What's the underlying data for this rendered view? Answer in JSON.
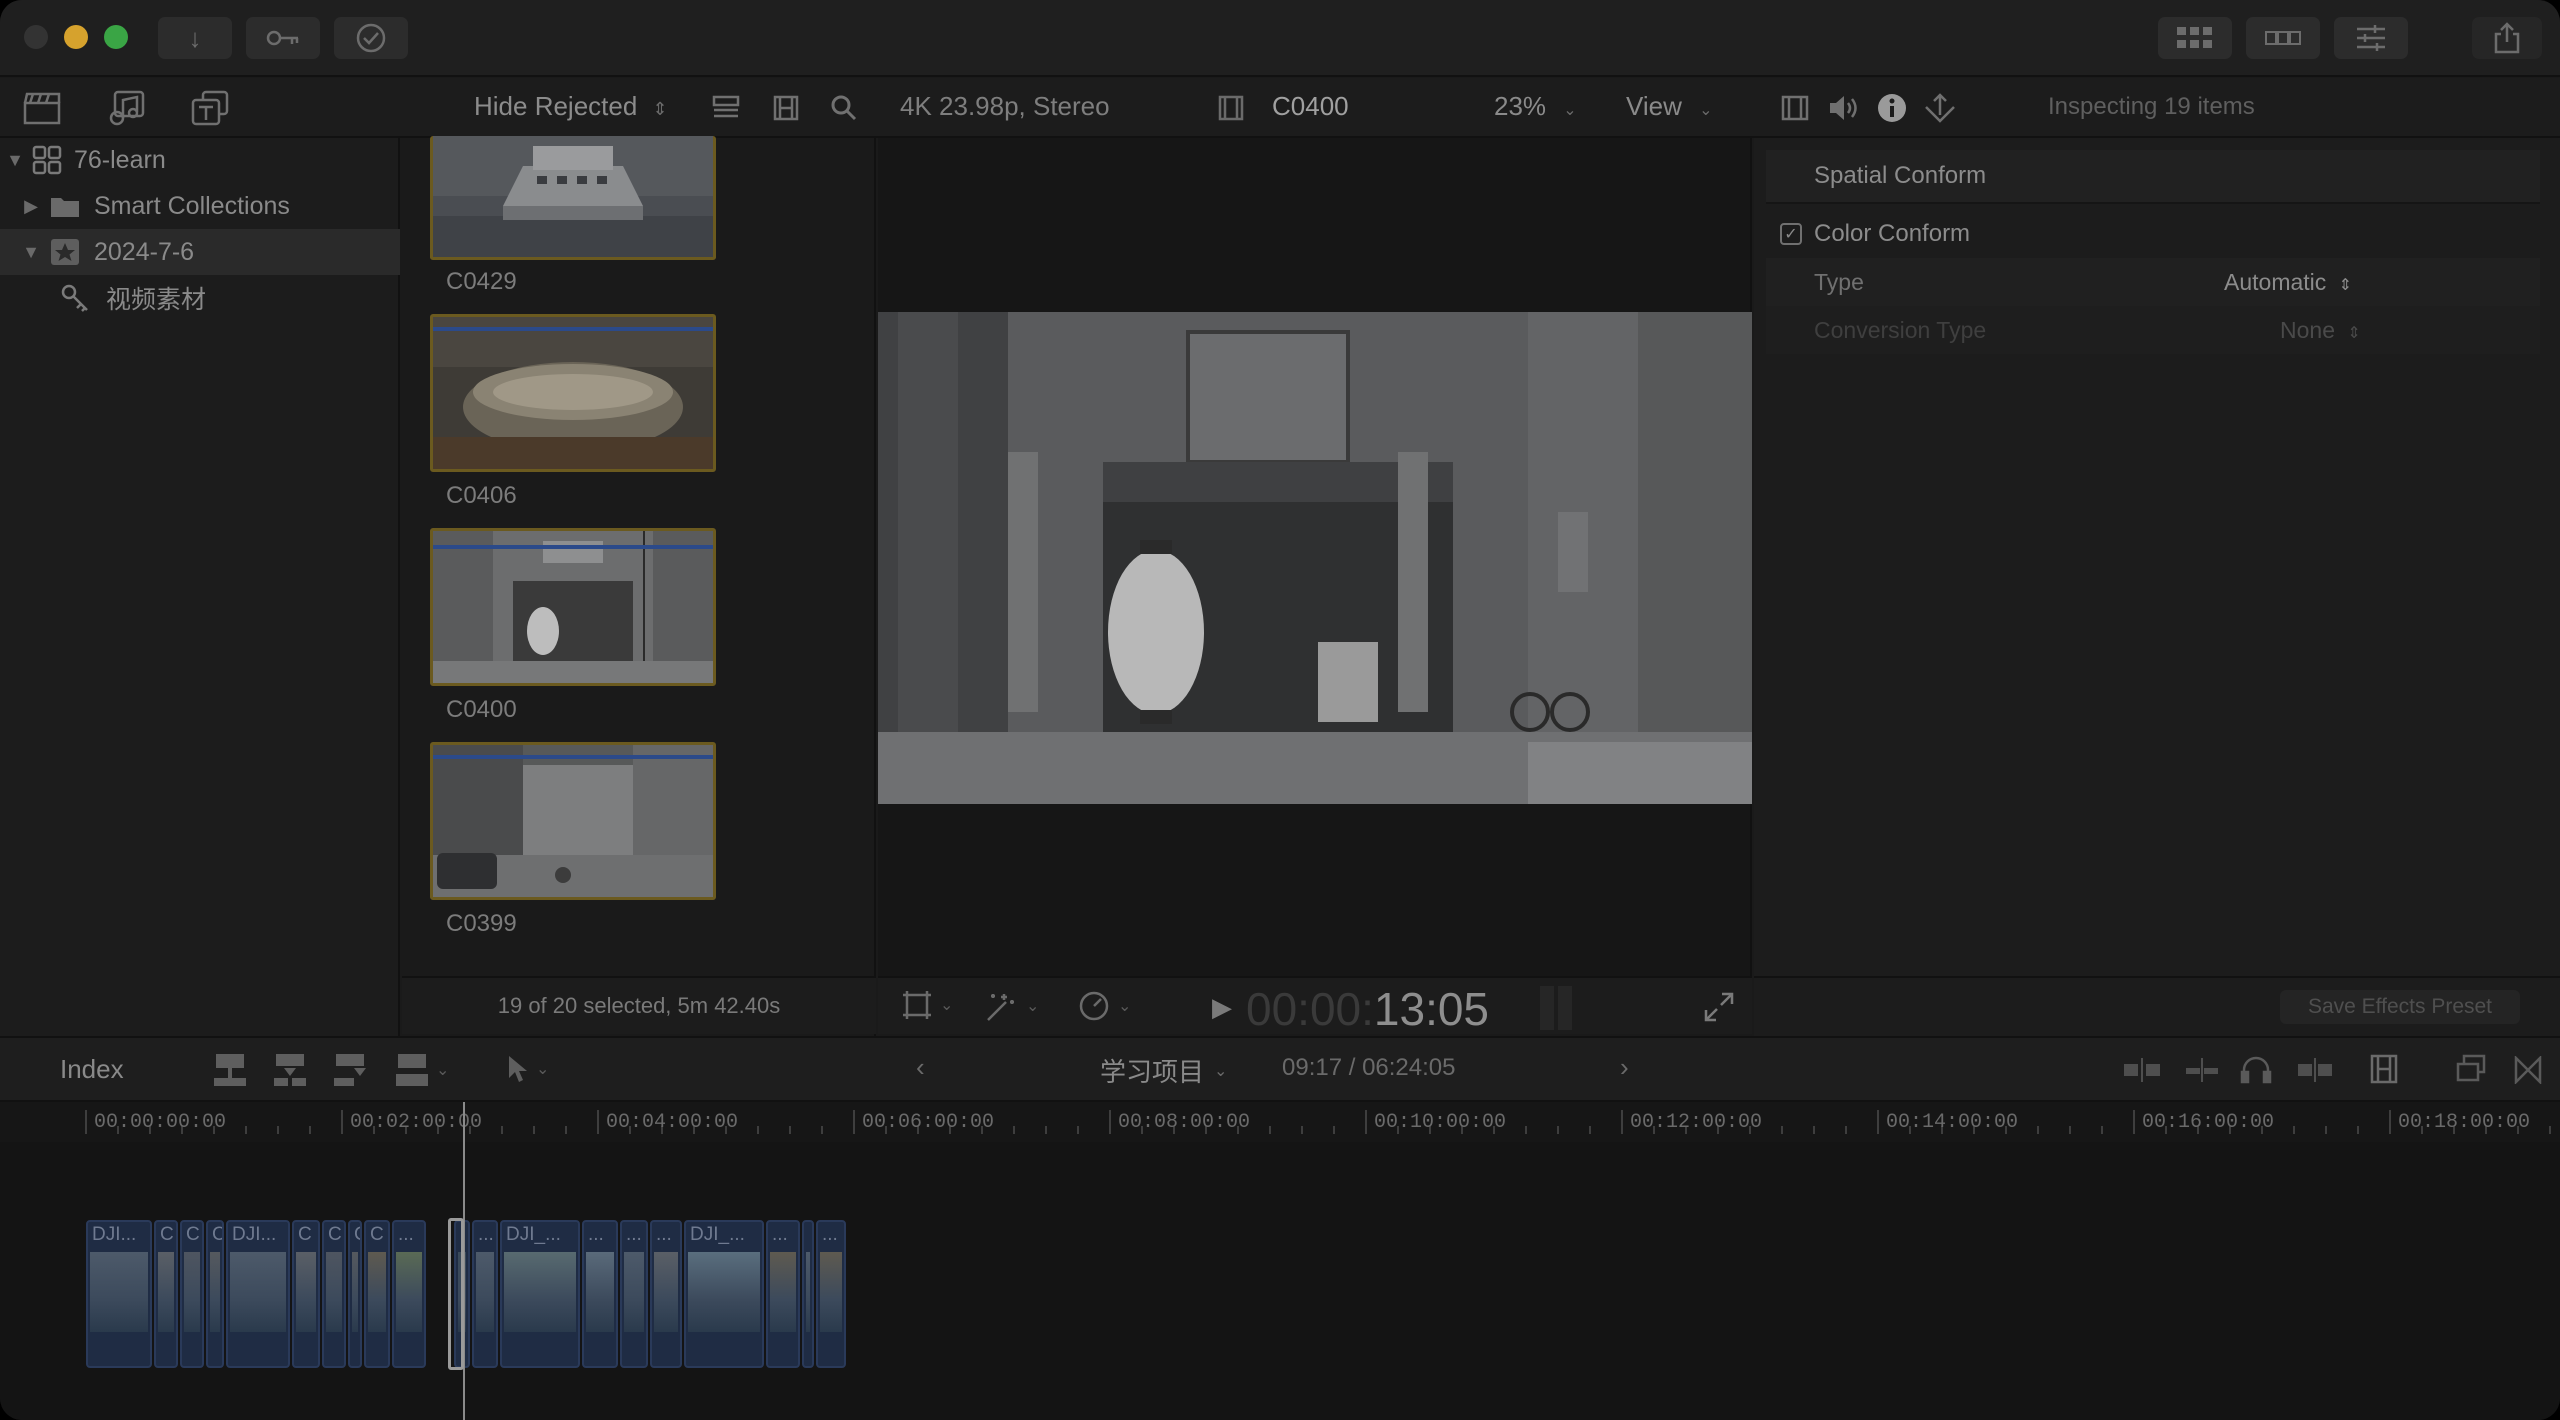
{
  "titlebar": {
    "import_icon": "download-arrow-icon",
    "keywords_icon": "key-icon",
    "background_tasks_icon": "checkmark-circle-icon",
    "layout_icons": [
      "grid-icon",
      "filmstrip-icon",
      "sliders-icon"
    ],
    "share_icon": "share-icon"
  },
  "browser_toolbar": {
    "filter": "Hide Rejected",
    "filter_chevron": "⌃⌄"
  },
  "library": {
    "name": "76-learn",
    "items": [
      {
        "label": "Smart Collections",
        "icon": "folder-icon"
      },
      {
        "label": "2024-7-6",
        "icon": "star-event-icon"
      },
      {
        "label": "视频素材",
        "icon": "keyword-icon"
      }
    ]
  },
  "browser": {
    "clips": [
      {
        "name": "C0429"
      },
      {
        "name": "C0406"
      },
      {
        "name": "C0400"
      },
      {
        "name": "C0399"
      }
    ],
    "status": "19 of 20 selected, 5m 42.40s"
  },
  "viewer": {
    "format": "4K 23.98p, Stereo",
    "clip_name": "C0400",
    "zoom": "23%",
    "view_label": "View",
    "timecode_dim": "00:00:",
    "timecode": "13:05"
  },
  "inspector": {
    "header": "Inspecting 19 items",
    "spatial_conform": "Spatial Conform",
    "color_conform": "Color Conform",
    "rows": [
      {
        "label": "Type",
        "value": "Automatic"
      },
      {
        "label": "Conversion Type",
        "value": "None"
      }
    ],
    "save_preset": "Save Effects Preset"
  },
  "timeline": {
    "index_label": "Index",
    "project_name": "学习项目",
    "position": "09:17 / 06:24:05",
    "ticks": [
      "00:00:00:00",
      "00:02:00:00",
      "00:04:00:00",
      "00:06:00:00",
      "00:08:00:00",
      "00:10:00:00",
      "00:12:00:00",
      "00:14:00:00",
      "00:16:00:00",
      "00:18:00:00"
    ],
    "clips": [
      "DJI...",
      "C",
      "C",
      "C",
      "DJI...",
      "C",
      "C",
      "C",
      "C",
      "...",
      "",
      "...",
      "DJI_...",
      "...",
      "...",
      "...",
      "DJI_...",
      "...",
      "",
      "..."
    ]
  },
  "colors": {
    "window_bg": "#1a1a1a",
    "thumb_border": "#6b5a1f",
    "clip_fill": "#1f2c44",
    "traffic_red": "#3a3a3a",
    "traffic_yellow": "#d6a22d",
    "traffic_green": "#3aa545"
  }
}
